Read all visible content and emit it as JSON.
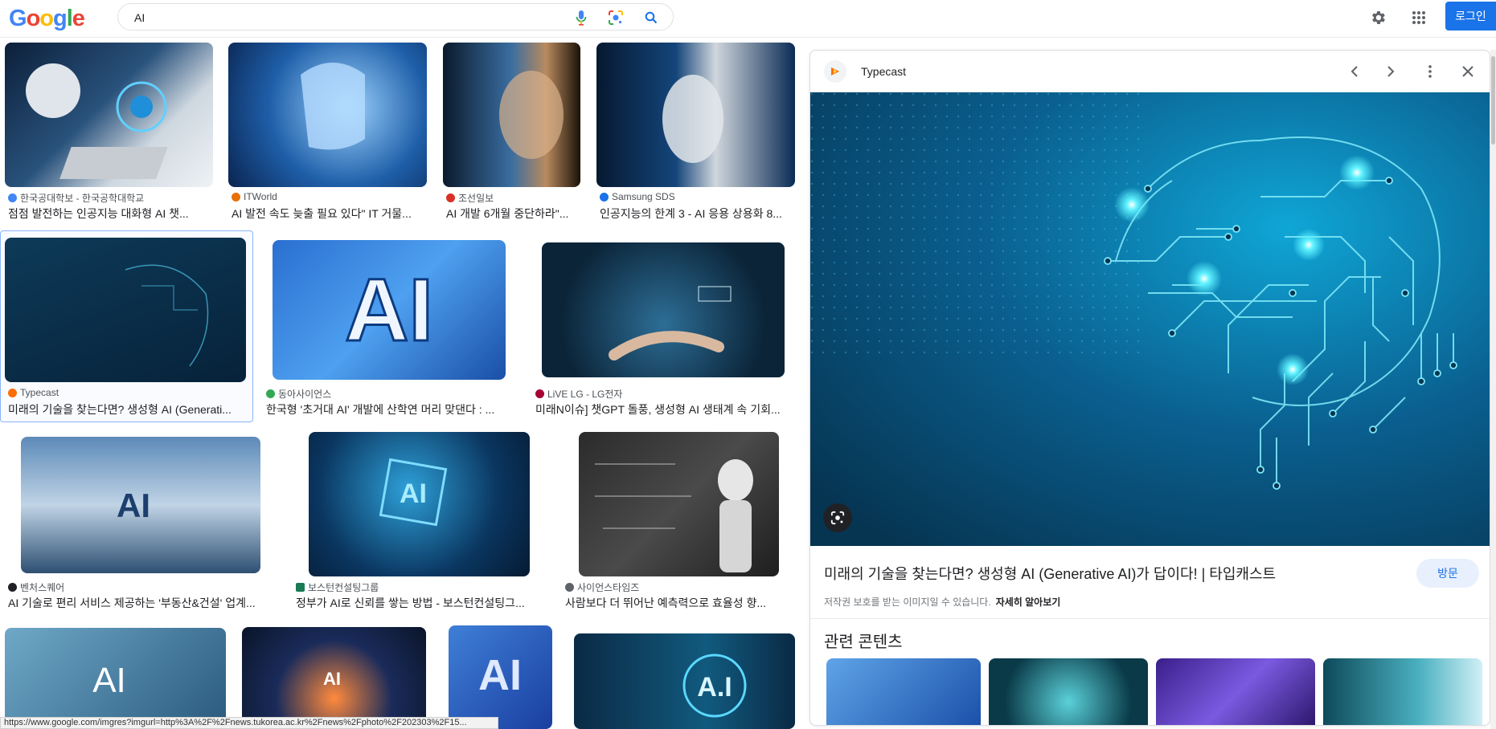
{
  "header": {
    "logo_letters": [
      "G",
      "o",
      "o",
      "g",
      "l",
      "e"
    ],
    "search_query": "AI",
    "login_label": "로그인",
    "icons": [
      "mic-icon",
      "lens-icon",
      "search-icon",
      "gear-icon",
      "apps-grid-icon"
    ]
  },
  "results": [
    {
      "source": "한국공대학보 - 한국공학대학교",
      "title": "점점 발전하는 인공지능 대화형 AI 챗...",
      "fav": "#4285f4"
    },
    {
      "source": "ITWorld",
      "title": "AI 발전 속도 늦출 필요 있다\" IT 거물...",
      "fav": "#e8710a"
    },
    {
      "source": "조선일보",
      "title": "AI 개발 6개월 중단하라\"...",
      "fav": "#d93025"
    },
    {
      "source": "Samsung SDS",
      "title": "인공지능의 한계 3 - AI 응용 상용화 8...",
      "fav": "#1a73e8"
    },
    {
      "source": "Typecast",
      "title": "미래의 기술을 찾는다면? 생성형 AI (Generati...",
      "fav": "#ff6d00"
    },
    {
      "source": "동아사이언스",
      "title": "한국형 '초거대 AI' 개발에 산학연 머리 맞댄다 : ...",
      "fav": "#34a853"
    },
    {
      "source": "LiVE LG - LG전자",
      "title": "미래N이슈] 챗GPT 돌풍, 생성형 AI 생태계 속 기회...",
      "fav": "#a50034"
    },
    {
      "source": "벤처스퀘어",
      "title": "AI 기술로 편리 서비스 제공하는 '부동산&건설' 업계...",
      "fav": "#202124"
    },
    {
      "source": "보스턴컨설팅그룹",
      "title": "정부가 AI로 신뢰를 쌓는 방법 - 보스턴컨설팅그...",
      "fav": "#197a56"
    },
    {
      "source": "사이언스타임즈",
      "title": "사람보다 더 뛰어난 예측력으로 효율성 향...",
      "fav": "#5f6368"
    }
  ],
  "panel": {
    "source": "Typecast",
    "title": "미래의 기술을 찾는다면? 생성형 AI (Generative AI)가 답이다! | 타입캐스트",
    "visit_label": "방문",
    "copyright": "저작권 보호를 받는 이미지일 수 있습니다.",
    "learn_more": "자세히 알아보기",
    "related_title": "관련 콘텐츠"
  },
  "status_url": "https://www.google.com/imgres?imgurl=http%3A%2F%2Fnews.tukorea.ac.kr%2Fnews%2Fphoto%2F202303%2F15...",
  "colors": {
    "accent": "#1a73e8",
    "brand_blue": "#4285f4",
    "brand_red": "#ea4335",
    "brand_yellow": "#fbbc05",
    "brand_green": "#34a853"
  }
}
